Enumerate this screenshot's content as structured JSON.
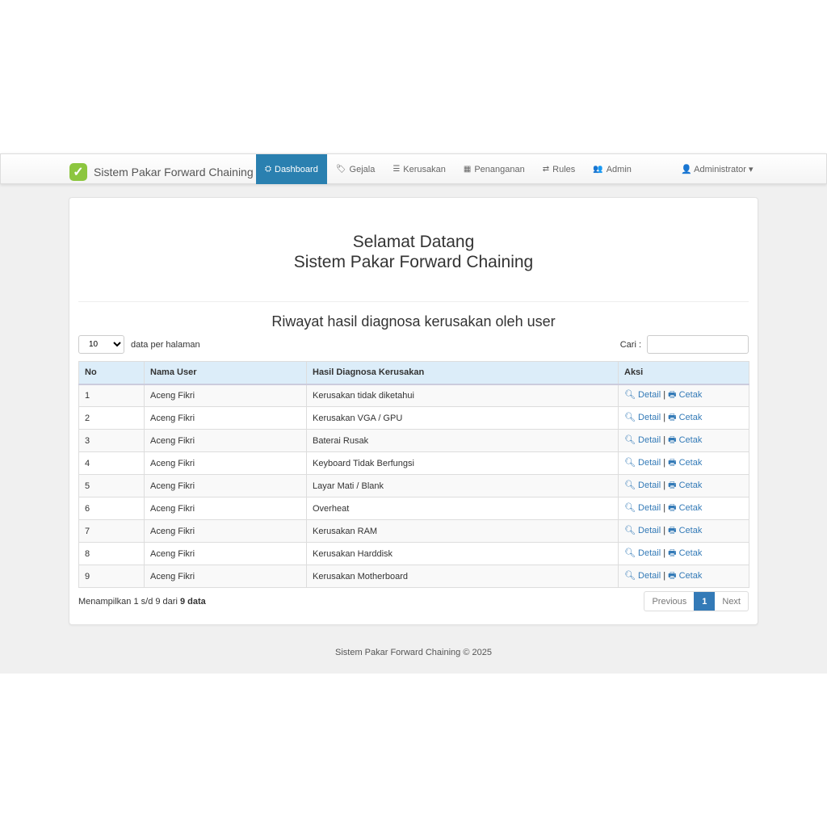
{
  "navbar": {
    "brand": "Sistem Pakar Forward Chaining",
    "items": [
      {
        "icon": "⛭",
        "label": "Dashboard"
      },
      {
        "icon": "🏷",
        "label": "Gejala"
      },
      {
        "icon": "☰",
        "label": "Kerusakan"
      },
      {
        "icon": "▦",
        "label": "Penanganan"
      },
      {
        "icon": "⇄",
        "label": "Rules"
      },
      {
        "icon": "👥",
        "label": "Admin"
      }
    ],
    "user": "Administrator"
  },
  "main": {
    "welcome_line1": "Selamat Datang",
    "welcome_line2": "Sistem Pakar Forward Chaining",
    "subtitle": "Riwayat hasil diagnosa kerusakan oleh user",
    "page_length": "10",
    "page_length_label": "data per halaman",
    "search_label": "Cari :",
    "search_value": "",
    "columns": [
      "No",
      "Nama User",
      "Hasil Diagnosa Kerusakan",
      "Aksi"
    ],
    "rows": [
      [
        "1",
        "Aceng Fikri",
        "Kerusakan tidak diketahui"
      ],
      [
        "2",
        "Aceng Fikri",
        "Kerusakan VGA / GPU"
      ],
      [
        "3",
        "Aceng Fikri",
        "Baterai Rusak"
      ],
      [
        "4",
        "Aceng Fikri",
        "Keyboard Tidak Berfungsi"
      ],
      [
        "5",
        "Aceng Fikri",
        "Layar Mati / Blank"
      ],
      [
        "6",
        "Aceng Fikri",
        "Overheat"
      ],
      [
        "7",
        "Aceng Fikri",
        "Kerusakan RAM"
      ],
      [
        "8",
        "Aceng Fikri",
        "Kerusakan Harddisk"
      ],
      [
        "9",
        "Aceng Fikri",
        "Kerusakan Motherboard"
      ]
    ],
    "detail_label": "Detail",
    "print_label": "Cetak",
    "separator": "|",
    "info_prefix": "Menampilkan 1 s/d 9 dari",
    "info_bold": "9 data",
    "pagination": {
      "previous": "Previous",
      "current": "1",
      "next": "Next"
    }
  },
  "footer": "Sistem Pakar Forward Chaining © 2025"
}
